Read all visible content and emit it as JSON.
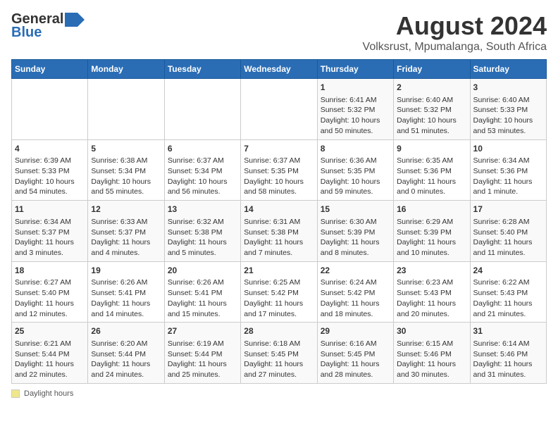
{
  "logo": {
    "general": "General",
    "blue": "Blue"
  },
  "title": "August 2024",
  "subtitle": "Volksrust, Mpumalanga, South Africa",
  "days_of_week": [
    "Sunday",
    "Monday",
    "Tuesday",
    "Wednesday",
    "Thursday",
    "Friday",
    "Saturday"
  ],
  "footer_label": "Daylight hours",
  "weeks": [
    [
      {
        "day": "",
        "content": ""
      },
      {
        "day": "",
        "content": ""
      },
      {
        "day": "",
        "content": ""
      },
      {
        "day": "",
        "content": ""
      },
      {
        "day": "1",
        "content": "Sunrise: 6:41 AM\nSunset: 5:32 PM\nDaylight: 10 hours\nand 50 minutes."
      },
      {
        "day": "2",
        "content": "Sunrise: 6:40 AM\nSunset: 5:32 PM\nDaylight: 10 hours\nand 51 minutes."
      },
      {
        "day": "3",
        "content": "Sunrise: 6:40 AM\nSunset: 5:33 PM\nDaylight: 10 hours\nand 53 minutes."
      }
    ],
    [
      {
        "day": "4",
        "content": "Sunrise: 6:39 AM\nSunset: 5:33 PM\nDaylight: 10 hours\nand 54 minutes."
      },
      {
        "day": "5",
        "content": "Sunrise: 6:38 AM\nSunset: 5:34 PM\nDaylight: 10 hours\nand 55 minutes."
      },
      {
        "day": "6",
        "content": "Sunrise: 6:37 AM\nSunset: 5:34 PM\nDaylight: 10 hours\nand 56 minutes."
      },
      {
        "day": "7",
        "content": "Sunrise: 6:37 AM\nSunset: 5:35 PM\nDaylight: 10 hours\nand 58 minutes."
      },
      {
        "day": "8",
        "content": "Sunrise: 6:36 AM\nSunset: 5:35 PM\nDaylight: 10 hours\nand 59 minutes."
      },
      {
        "day": "9",
        "content": "Sunrise: 6:35 AM\nSunset: 5:36 PM\nDaylight: 11 hours\nand 0 minutes."
      },
      {
        "day": "10",
        "content": "Sunrise: 6:34 AM\nSunset: 5:36 PM\nDaylight: 11 hours\nand 1 minute."
      }
    ],
    [
      {
        "day": "11",
        "content": "Sunrise: 6:34 AM\nSunset: 5:37 PM\nDaylight: 11 hours\nand 3 minutes."
      },
      {
        "day": "12",
        "content": "Sunrise: 6:33 AM\nSunset: 5:37 PM\nDaylight: 11 hours\nand 4 minutes."
      },
      {
        "day": "13",
        "content": "Sunrise: 6:32 AM\nSunset: 5:38 PM\nDaylight: 11 hours\nand 5 minutes."
      },
      {
        "day": "14",
        "content": "Sunrise: 6:31 AM\nSunset: 5:38 PM\nDaylight: 11 hours\nand 7 minutes."
      },
      {
        "day": "15",
        "content": "Sunrise: 6:30 AM\nSunset: 5:39 PM\nDaylight: 11 hours\nand 8 minutes."
      },
      {
        "day": "16",
        "content": "Sunrise: 6:29 AM\nSunset: 5:39 PM\nDaylight: 11 hours\nand 10 minutes."
      },
      {
        "day": "17",
        "content": "Sunrise: 6:28 AM\nSunset: 5:40 PM\nDaylight: 11 hours\nand 11 minutes."
      }
    ],
    [
      {
        "day": "18",
        "content": "Sunrise: 6:27 AM\nSunset: 5:40 PM\nDaylight: 11 hours\nand 12 minutes."
      },
      {
        "day": "19",
        "content": "Sunrise: 6:26 AM\nSunset: 5:41 PM\nDaylight: 11 hours\nand 14 minutes."
      },
      {
        "day": "20",
        "content": "Sunrise: 6:26 AM\nSunset: 5:41 PM\nDaylight: 11 hours\nand 15 minutes."
      },
      {
        "day": "21",
        "content": "Sunrise: 6:25 AM\nSunset: 5:42 PM\nDaylight: 11 hours\nand 17 minutes."
      },
      {
        "day": "22",
        "content": "Sunrise: 6:24 AM\nSunset: 5:42 PM\nDaylight: 11 hours\nand 18 minutes."
      },
      {
        "day": "23",
        "content": "Sunrise: 6:23 AM\nSunset: 5:43 PM\nDaylight: 11 hours\nand 20 minutes."
      },
      {
        "day": "24",
        "content": "Sunrise: 6:22 AM\nSunset: 5:43 PM\nDaylight: 11 hours\nand 21 minutes."
      }
    ],
    [
      {
        "day": "25",
        "content": "Sunrise: 6:21 AM\nSunset: 5:44 PM\nDaylight: 11 hours\nand 22 minutes."
      },
      {
        "day": "26",
        "content": "Sunrise: 6:20 AM\nSunset: 5:44 PM\nDaylight: 11 hours\nand 24 minutes."
      },
      {
        "day": "27",
        "content": "Sunrise: 6:19 AM\nSunset: 5:44 PM\nDaylight: 11 hours\nand 25 minutes."
      },
      {
        "day": "28",
        "content": "Sunrise: 6:18 AM\nSunset: 5:45 PM\nDaylight: 11 hours\nand 27 minutes."
      },
      {
        "day": "29",
        "content": "Sunrise: 6:16 AM\nSunset: 5:45 PM\nDaylight: 11 hours\nand 28 minutes."
      },
      {
        "day": "30",
        "content": "Sunrise: 6:15 AM\nSunset: 5:46 PM\nDaylight: 11 hours\nand 30 minutes."
      },
      {
        "day": "31",
        "content": "Sunrise: 6:14 AM\nSunset: 5:46 PM\nDaylight: 11 hours\nand 31 minutes."
      }
    ]
  ]
}
